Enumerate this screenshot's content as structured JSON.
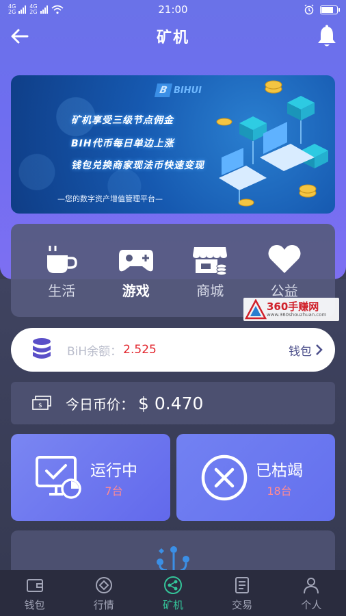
{
  "status_bar": {
    "signal_top": "4G",
    "signal_bottom": "2G",
    "network_top": "4G",
    "network_bottom": "2G",
    "time": "21:00"
  },
  "header": {
    "title": "矿机"
  },
  "banner": {
    "brand": "BIHUI",
    "line1": "矿机享受三级节点佣金",
    "line2": "BIH代币每日单边上涨",
    "line3": "钱包兑换商家现法币快速变现",
    "subtitle": "—您的数字资产增值管理平台—"
  },
  "categories": [
    {
      "label": "生活",
      "icon": "coffee-cup-icon"
    },
    {
      "label": "游戏",
      "icon": "gamepad-icon",
      "active": true
    },
    {
      "label": "商城",
      "icon": "store-icon"
    },
    {
      "label": "公益",
      "icon": "heart-icon"
    }
  ],
  "watermark": {
    "text": "360手赚网",
    "url": "www.360shouzhuan.com"
  },
  "balance": {
    "label": "BiH余额：",
    "value": "2.525",
    "link": "钱包"
  },
  "price": {
    "label": "今日币价：",
    "value": "$ 0.470"
  },
  "machines": {
    "running": {
      "title": "运行中",
      "count": "7台",
      "icon": "monitor-check-icon"
    },
    "dead": {
      "title": "已枯竭",
      "count": "18台",
      "icon": "circle-x-icon"
    }
  },
  "tabs": [
    {
      "label": "钱包",
      "icon": "wallet-icon"
    },
    {
      "label": "行情",
      "icon": "market-icon"
    },
    {
      "label": "矿机",
      "icon": "share-nodes-icon",
      "active": true
    },
    {
      "label": "交易",
      "icon": "document-icon"
    },
    {
      "label": "个人",
      "icon": "user-icon"
    }
  ],
  "colors": {
    "accent_purple": "#6b70ee",
    "active_tab": "#34c59a",
    "balance_value": "#e2242c",
    "dark_bg": "#3a3d55"
  }
}
